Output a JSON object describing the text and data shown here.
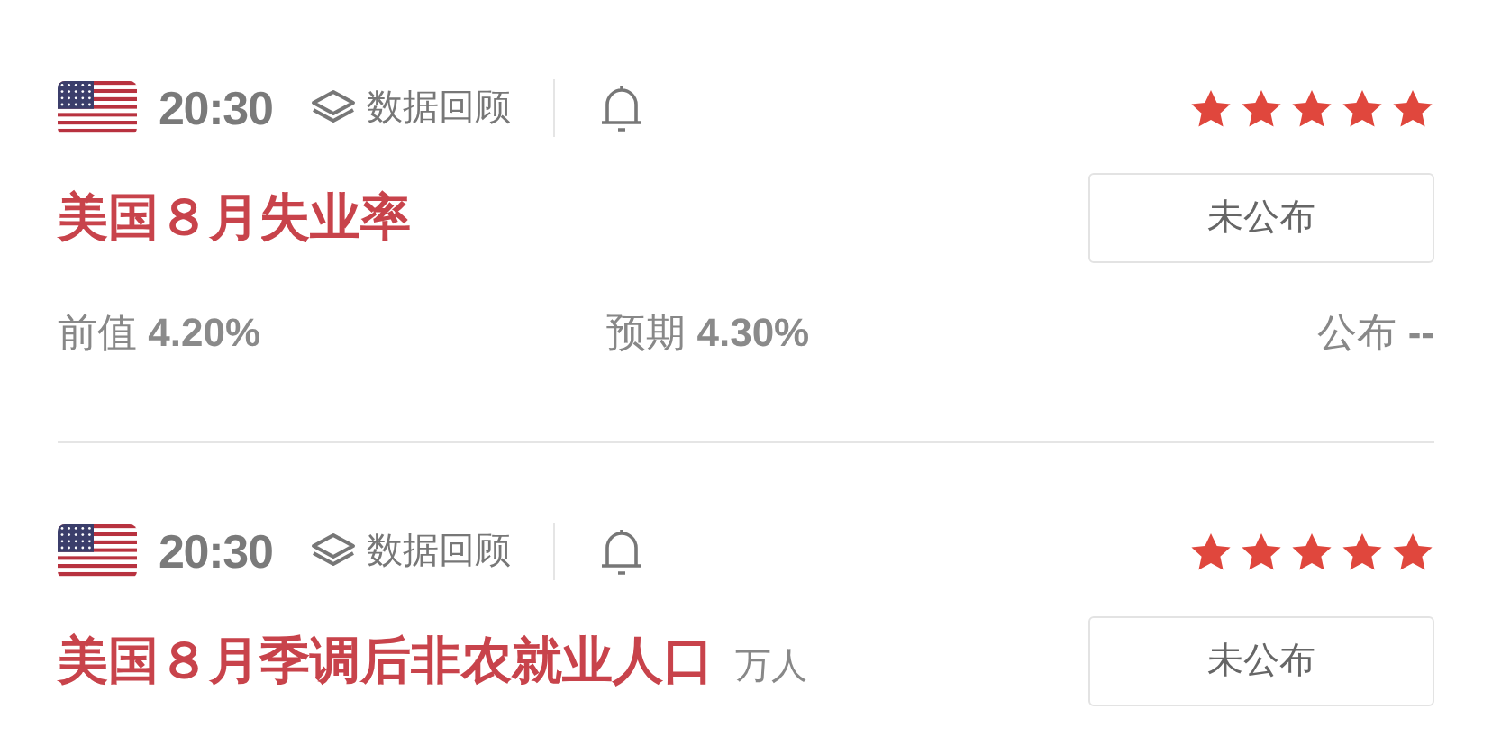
{
  "events": [
    {
      "time": "20:30",
      "review": "数据回顾",
      "stars": 5,
      "title": "美国８月失业率",
      "status": "未公布",
      "values": [
        {
          "label": "前值",
          "value": "4.20%"
        },
        {
          "label": "预期",
          "value": "4.30%"
        },
        {
          "label": "公布",
          "value": "--"
        }
      ]
    },
    {
      "time": "20:30",
      "review": "数据回顾",
      "stars": 5,
      "title": "美国８月季调后非农就业人口",
      "unit": "万人",
      "status": "未公布"
    }
  ]
}
